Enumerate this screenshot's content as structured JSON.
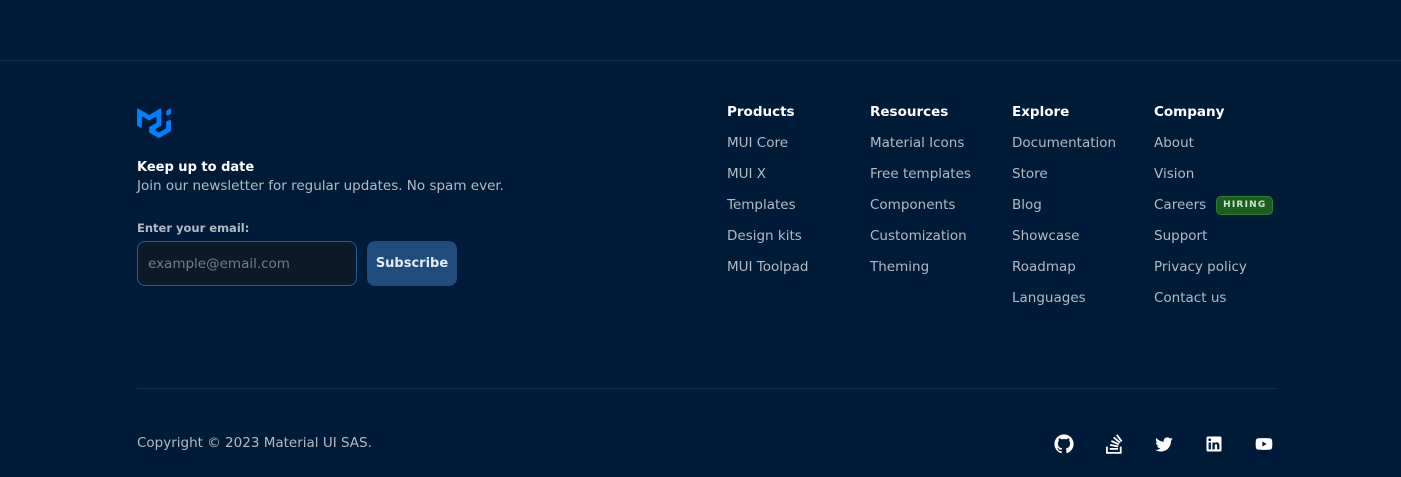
{
  "newsletter": {
    "logo_icon": "mui-logo-icon",
    "title": "Keep up to date",
    "description": "Join our newsletter for regular updates. No spam ever.",
    "email_label": "Enter your email:",
    "email_placeholder": "example@email.com",
    "email_value": "",
    "subscribe_label": "Subscribe"
  },
  "columns": [
    {
      "title": "Products",
      "links": [
        "MUI Core",
        "MUI X",
        "Templates",
        "Design kits",
        "MUI Toolpad"
      ]
    },
    {
      "title": "Resources",
      "links": [
        "Material Icons",
        "Free templates",
        "Components",
        "Customization",
        "Theming"
      ]
    },
    {
      "title": "Explore",
      "links": [
        "Documentation",
        "Store",
        "Blog",
        "Showcase",
        "Roadmap",
        "Languages"
      ]
    },
    {
      "title": "Company",
      "links": [
        "About",
        "Vision",
        "Careers",
        "Support",
        "Privacy policy",
        "Contact us"
      ],
      "careers_badge": "HIRING"
    }
  ],
  "footer": {
    "copyright": "Copyright © 2023 Material UI SAS.",
    "social_icons": [
      "github-icon",
      "stackoverflow-icon",
      "twitter-icon",
      "linkedin-icon",
      "youtube-icon"
    ]
  },
  "colors": {
    "background": "#001b38",
    "divider": "#132f4c",
    "primary": "#007fff",
    "heading": "#ffffff",
    "text": "#b2bac2",
    "hiring_badge_bg": "#1b5e20"
  }
}
